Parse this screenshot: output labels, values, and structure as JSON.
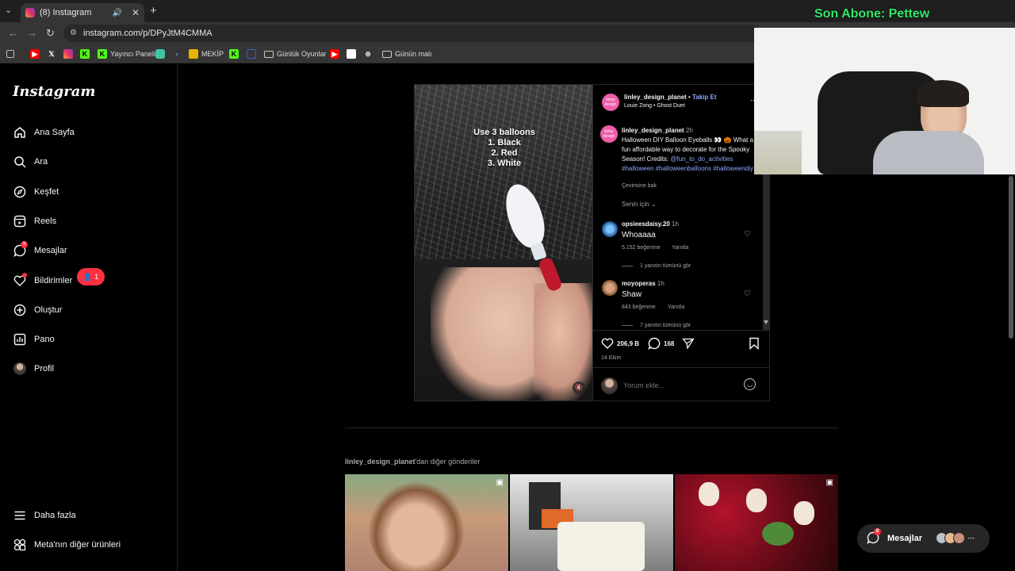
{
  "browser": {
    "tab_title": "(8) Instagram",
    "url": "instagram.com/p/DPyJtM4CMMA",
    "bookmarks": [
      "Yayıncı Paneli",
      "MEKİP",
      "Günlük Oyunlar",
      "Günün malı"
    ]
  },
  "overlay": {
    "subscriber_text": "Son Abone: Pettew"
  },
  "sidebar": {
    "logo": "Instagram",
    "items": [
      {
        "label": "Ana Sayfa",
        "icon": "home-icon"
      },
      {
        "label": "Ara",
        "icon": "search-icon"
      },
      {
        "label": "Keşfet",
        "icon": "compass-icon"
      },
      {
        "label": "Reels",
        "icon": "reels-icon"
      },
      {
        "label": "Mesajlar",
        "icon": "messenger-icon",
        "badge": "8"
      },
      {
        "label": "Bildirimler",
        "icon": "heart-icon"
      },
      {
        "label": "Oluştur",
        "icon": "plus-square-icon"
      },
      {
        "label": "Pano",
        "icon": "dashboard-icon"
      },
      {
        "label": "Profil",
        "icon": "avatar"
      }
    ],
    "notification_count": "1",
    "more_label": "Daha fazla",
    "meta_label": "Meta'nın diğer ürünleri"
  },
  "post": {
    "video_overlay_lines": [
      "Use 3 balloons",
      "1. Black",
      "2. Red",
      "3. White"
    ],
    "author": "linley_design_planet",
    "follow_label": "Takip Et",
    "audio": "Louie Zong • Ghost Duet",
    "caption_time": "2h",
    "caption_text": "Halloween DIY Balloon Eyeballs 👀 🎃 What a fun affordable way to decorate for the Spooky Season! Credits:",
    "caption_tags": "@fun_to_do_activities #halloween #halloweenballoons #halloweendiy",
    "translate_label": "Çevirisine bak",
    "sort_label": "Senin için",
    "comments": [
      {
        "user": "opsieesdaisy.20",
        "time": "1h",
        "text": "Whoaaaa",
        "likes": "5.152 beğenme",
        "reply": "Yanıtla",
        "view_replies": "1 yanıtın tümünü gör"
      },
      {
        "user": "moyoperas",
        "time": "1h",
        "text": "Shaw",
        "likes": "843 beğenme",
        "reply": "Yanıtla",
        "view_replies": "7 yanıtın tümünü gör"
      }
    ],
    "like_count": "206,9 B",
    "comment_count": "168",
    "date": "14 Ekim",
    "comment_placeholder": "Yorum ekle..."
  },
  "more_posts": {
    "author": "linley_design_planet",
    "suffix": "'dan diğer gönderiler"
  },
  "messages_pill": {
    "label": "Mesajlar",
    "badge": "8"
  },
  "colors": {
    "accent": "#ff3040",
    "link": "#8aa6ff",
    "overlay_green": "#33e76b"
  }
}
